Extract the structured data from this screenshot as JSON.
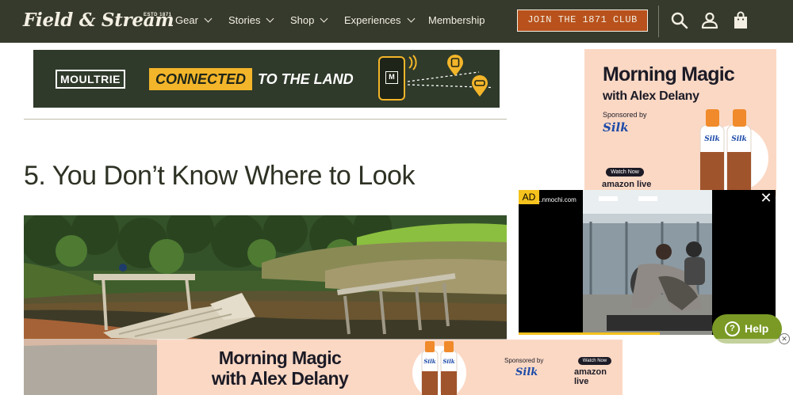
{
  "header": {
    "logo": "Field & Stream",
    "logo_est": "ESTD 1871",
    "menu": [
      {
        "label": "Gear"
      },
      {
        "label": "Stories"
      },
      {
        "label": "Shop"
      },
      {
        "label": "Experiences"
      },
      {
        "label": "Membership"
      }
    ],
    "cta_label": "JOIN THE 1871 CLUB",
    "icons": [
      "search-icon",
      "account-icon",
      "bag-icon"
    ]
  },
  "banner_ad": {
    "brand": "MOULTRIE",
    "highlight": "CONNECTED",
    "tagline": "TO THE LAND",
    "phone_mark": "M"
  },
  "article": {
    "headline": "5. You Don’t Know Where to Look"
  },
  "side_ad": {
    "title": "Morning Magic",
    "subtitle": "with Alex Delany",
    "sponsored": "Sponsored by",
    "brand": "Silk",
    "watch": "Watch Now",
    "platform": "amazon live"
  },
  "video_ad": {
    "ad_label": "AD",
    "domain": "...nmochi.com",
    "close": "✕",
    "progress": 0.55
  },
  "help": {
    "label": "Help",
    "q": "?"
  },
  "sticky_ad": {
    "title_line1": "Morning Magic",
    "title_line2": "with Alex Delany",
    "sponsored": "Sponsored by",
    "brand": "Silk",
    "watch": "Watch Now",
    "platform": "amazon live",
    "close": "✕"
  },
  "colors": {
    "nav_bg": "#363a2c",
    "cta_bg": "#b8511c",
    "accent_yellow": "#f3b52a",
    "ad_peach": "#fbd8c4",
    "help_green": "#7a9a25"
  }
}
